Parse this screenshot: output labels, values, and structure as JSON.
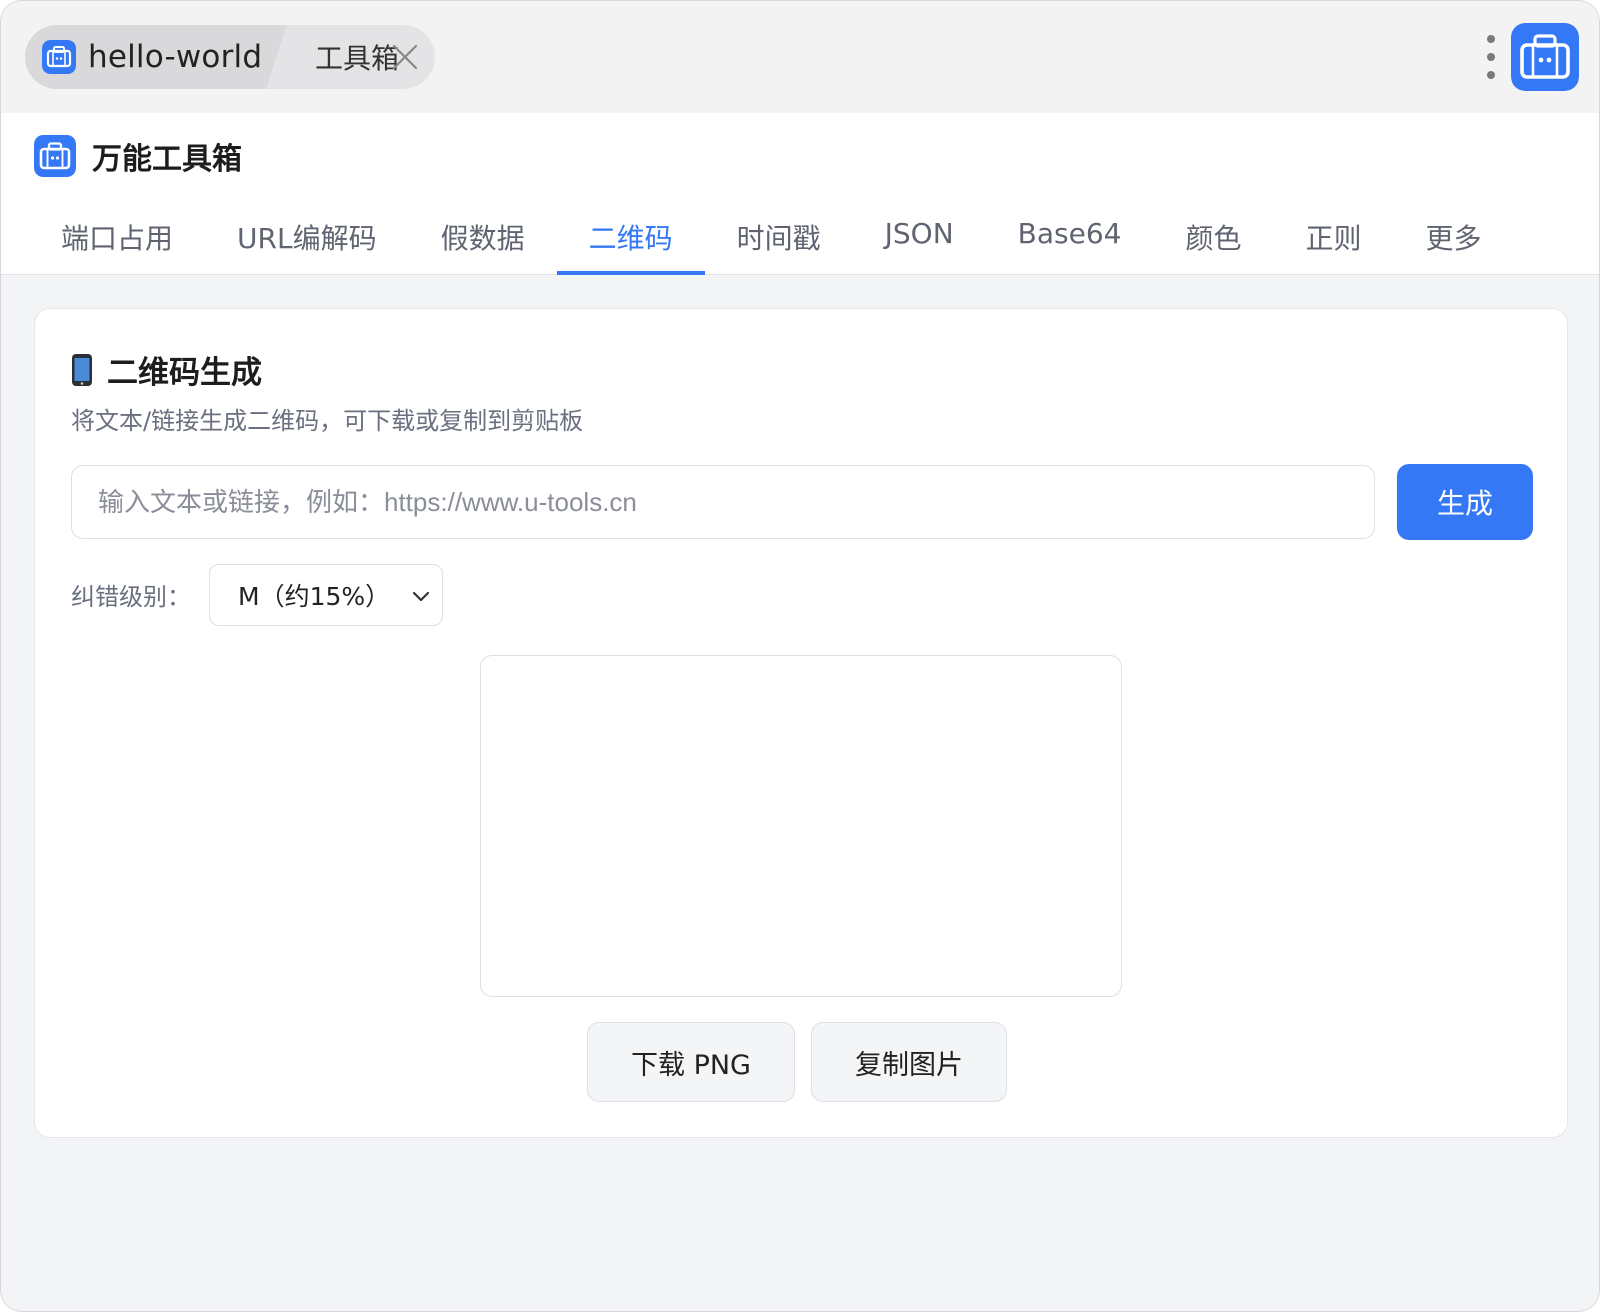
{
  "chrome": {
    "active_tab_label": "hello-world",
    "second_tab_label": "工具箱"
  },
  "header": {
    "brand_title": "万能工具箱"
  },
  "nav": {
    "tabs": [
      {
        "label": "端口占用",
        "active": false
      },
      {
        "label": "URL编解码",
        "active": false
      },
      {
        "label": "假数据",
        "active": false
      },
      {
        "label": "二维码",
        "active": true
      },
      {
        "label": "时间戳",
        "active": false
      },
      {
        "label": "JSON",
        "active": false
      },
      {
        "label": "Base64",
        "active": false
      },
      {
        "label": "颜色",
        "active": false
      },
      {
        "label": "正则",
        "active": false
      },
      {
        "label": "更多",
        "active": false
      }
    ]
  },
  "qr": {
    "title": "二维码生成",
    "description": "将文本/链接生成二维码，可下载或复制到剪贴板",
    "input_value": "",
    "input_placeholder": "输入文本或链接，例如：https://www.u-tools.cn",
    "generate_label": "生成",
    "level_label": "纠错级别：",
    "level_selected": "M（约15%）",
    "download_label": "下载 PNG",
    "copy_label": "复制图片"
  },
  "colors": {
    "accent": "#3478f6",
    "window_bg": "#f3f4f6",
    "icon_bg": "#3478f6"
  }
}
